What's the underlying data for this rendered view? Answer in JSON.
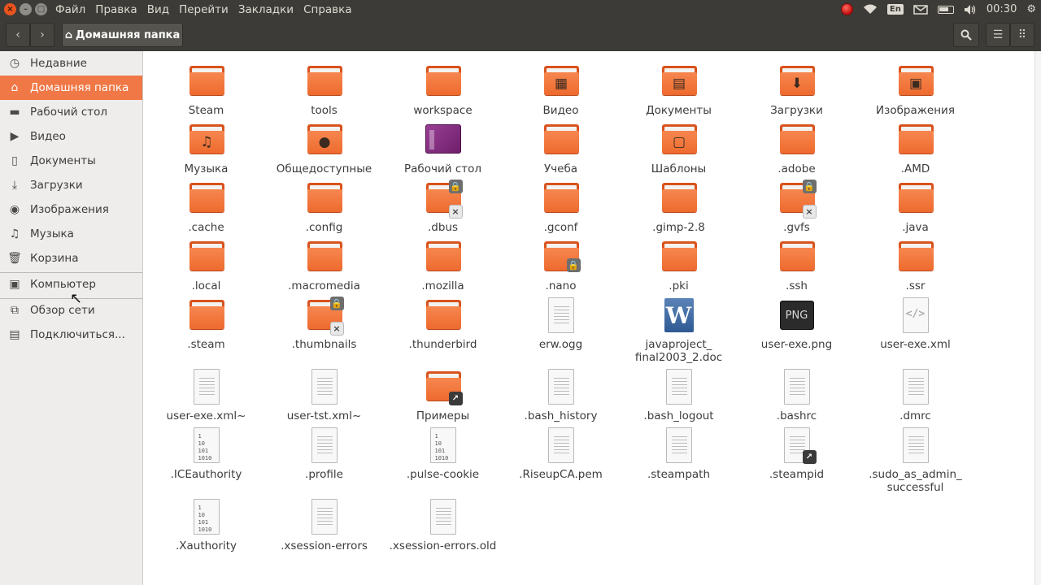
{
  "menubar": {
    "items": [
      "Файл",
      "Правка",
      "Вид",
      "Перейти",
      "Закладки",
      "Справка"
    ],
    "lang": "En",
    "time": "00:30"
  },
  "toolbar": {
    "path_label": "Домашняя папка"
  },
  "sidebar": {
    "items": [
      {
        "label": "Недавние",
        "icon": "clock-icon"
      },
      {
        "label": "Домашняя папка",
        "icon": "home-icon"
      },
      {
        "label": "Рабочий стол",
        "icon": "desktop-icon"
      },
      {
        "label": "Видео",
        "icon": "video-icon"
      },
      {
        "label": "Документы",
        "icon": "document-icon"
      },
      {
        "label": "Загрузки",
        "icon": "download-icon"
      },
      {
        "label": "Изображения",
        "icon": "camera-icon"
      },
      {
        "label": "Музыка",
        "icon": "music-icon"
      },
      {
        "label": "Корзина",
        "icon": "trash-icon"
      },
      {
        "label": "Компьютер",
        "icon": "computer-icon"
      },
      {
        "label": "Обзор сети",
        "icon": "network-icon"
      },
      {
        "label": "Подключиться...",
        "icon": "connect-icon"
      }
    ]
  },
  "files": [
    {
      "name": "Steam",
      "kind": "folder"
    },
    {
      "name": "tools",
      "kind": "folder"
    },
    {
      "name": "workspace",
      "kind": "folder"
    },
    {
      "name": "Видео",
      "kind": "folder",
      "emblem": "film"
    },
    {
      "name": "Документы",
      "kind": "folder",
      "emblem": "doc"
    },
    {
      "name": "Загрузки",
      "kind": "folder",
      "emblem": "down"
    },
    {
      "name": "Изображения",
      "kind": "folder",
      "emblem": "photo"
    },
    {
      "name": "Музыка",
      "kind": "folder",
      "emblem": "music"
    },
    {
      "name": "Общедоступные",
      "kind": "folder",
      "emblem": "person"
    },
    {
      "name": "Рабочий стол",
      "kind": "desktop"
    },
    {
      "name": "Учеба",
      "kind": "folder"
    },
    {
      "name": "Шаблоны",
      "kind": "folder",
      "emblem": "template"
    },
    {
      "name": ".adobe",
      "kind": "folder"
    },
    {
      "name": ".AMD",
      "kind": "folder"
    },
    {
      "name": ".cache",
      "kind": "folder"
    },
    {
      "name": ".config",
      "kind": "folder"
    },
    {
      "name": ".dbus",
      "kind": "folder",
      "badges": [
        "lock",
        "x"
      ]
    },
    {
      "name": ".gconf",
      "kind": "folder"
    },
    {
      "name": ".gimp-2.8",
      "kind": "folder"
    },
    {
      "name": ".gvfs",
      "kind": "folder",
      "badges": [
        "lock",
        "x"
      ]
    },
    {
      "name": ".java",
      "kind": "folder"
    },
    {
      "name": ".local",
      "kind": "folder"
    },
    {
      "name": ".macromedia",
      "kind": "folder"
    },
    {
      "name": ".mozilla",
      "kind": "folder"
    },
    {
      "name": ".nano",
      "kind": "folder",
      "badges": [
        "lock-bottom"
      ]
    },
    {
      "name": ".pki",
      "kind": "folder"
    },
    {
      "name": ".ssh",
      "kind": "folder"
    },
    {
      "name": ".ssr",
      "kind": "folder"
    },
    {
      "name": ".steam",
      "kind": "folder"
    },
    {
      "name": ".thumbnails",
      "kind": "folder",
      "badges": [
        "lock",
        "x"
      ]
    },
    {
      "name": ".thunderbird",
      "kind": "folder"
    },
    {
      "name": "erw.ogg",
      "kind": "text"
    },
    {
      "name": "javaproject_\nfinal2003_2.doc",
      "kind": "word"
    },
    {
      "name": "user-exe.png",
      "kind": "png"
    },
    {
      "name": "user-exe.xml",
      "kind": "xml"
    },
    {
      "name": "user-exe.xml~",
      "kind": "text"
    },
    {
      "name": "user-tst.xml~",
      "kind": "text"
    },
    {
      "name": "Примеры",
      "kind": "folder",
      "badges": [
        "link"
      ]
    },
    {
      "name": ".bash_history",
      "kind": "text"
    },
    {
      "name": ".bash_logout",
      "kind": "text"
    },
    {
      "name": ".bashrc",
      "kind": "text"
    },
    {
      "name": ".dmrc",
      "kind": "text"
    },
    {
      "name": ".ICEauthority",
      "kind": "binary"
    },
    {
      "name": ".profile",
      "kind": "text"
    },
    {
      "name": ".pulse-cookie",
      "kind": "binary"
    },
    {
      "name": ".RiseupCA.pem",
      "kind": "text"
    },
    {
      "name": ".steampath",
      "kind": "text"
    },
    {
      "name": ".steampid",
      "kind": "text",
      "badges": [
        "link"
      ]
    },
    {
      "name": ".sudo_as_admin_\nsuccessful",
      "kind": "text"
    },
    {
      "name": ".Xauthority",
      "kind": "binary"
    },
    {
      "name": ".xsession-errors",
      "kind": "text"
    },
    {
      "name": ".xsession-errors.old",
      "kind": "text"
    }
  ],
  "colors": {
    "accent": "#f07746",
    "panel": "#3c3b37",
    "folder": "#ee6a2e"
  }
}
